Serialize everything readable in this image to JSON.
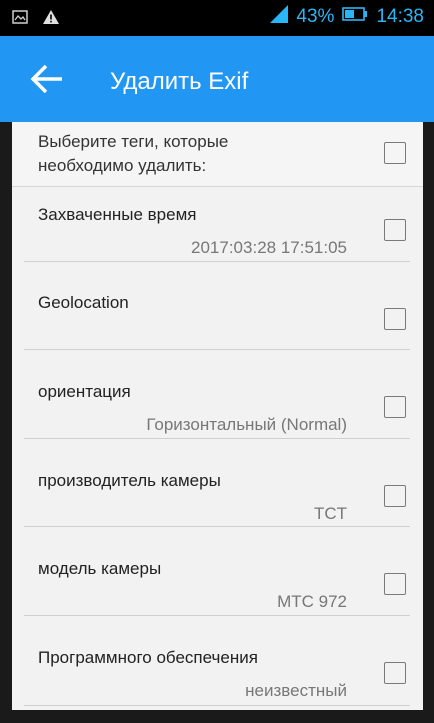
{
  "status_bar": {
    "battery_percent": "43%",
    "time": "14:38",
    "icons": [
      "gallery-icon",
      "warning-icon",
      "signal-icon",
      "battery-icon"
    ]
  },
  "app_bar": {
    "title": "Удалить Exif",
    "color": "#2196f3"
  },
  "dialog": {
    "instruction": "Выберите теги, которые необходимо удалить:",
    "items": [
      {
        "label": "Захваченные время",
        "value": "2017:03:28 17:51:05",
        "checked": false
      },
      {
        "label": "Geolocation",
        "value": "",
        "checked": false
      },
      {
        "label": "ориентация",
        "value": "Горизонтальный (Normal)",
        "checked": false
      },
      {
        "label": "производитель камеры",
        "value": "TCT",
        "checked": false
      },
      {
        "label": "модель камеры",
        "value": "MTC 972",
        "checked": false
      },
      {
        "label": "Программного обеспечения",
        "value": "неизвестный",
        "checked": false
      }
    ]
  }
}
